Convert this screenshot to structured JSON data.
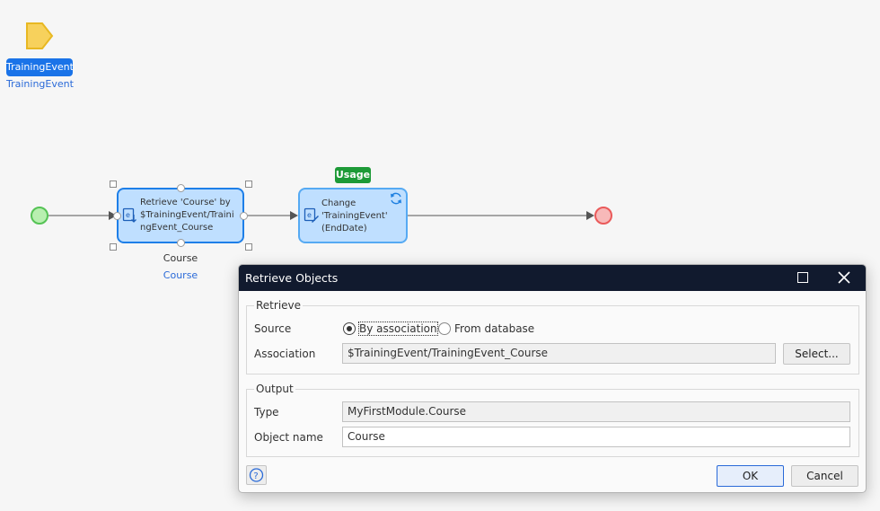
{
  "canvas": {
    "parameter": {
      "chip_label": "TrainingEvent",
      "link_label": "TrainingEvent"
    },
    "retrieve_activity": {
      "text": "Retrieve 'Course' by $TrainingEvent/TrainingEvent_Course",
      "output_label": "Course",
      "output_link": "Course"
    },
    "change_activity": {
      "text": "Change 'TrainingEvent' (EndDate)"
    },
    "usage_badge": "Usage",
    "colors": {
      "accent": "#1a73e8",
      "start": "#55c355",
      "end": "#ea5a5a",
      "usage": "#1d9a37"
    },
    "icons": [
      "parameter-icon",
      "retrieve-icon",
      "change-object-icon",
      "refresh-icon"
    ]
  },
  "dialog": {
    "title": "Retrieve Objects",
    "retrieve_group": {
      "legend": "Retrieve",
      "source_label": "Source",
      "source_options": [
        "By association",
        "From database"
      ],
      "source_selected": "By association",
      "association_label": "Association",
      "association_value": "$TrainingEvent/TrainingEvent_Course",
      "select_button": "Select..."
    },
    "output_group": {
      "legend": "Output",
      "type_label": "Type",
      "type_value": "MyFirstModule.Course",
      "object_name_label": "Object name",
      "object_name_value": "Course"
    },
    "buttons": {
      "ok": "OK",
      "cancel": "Cancel"
    }
  }
}
